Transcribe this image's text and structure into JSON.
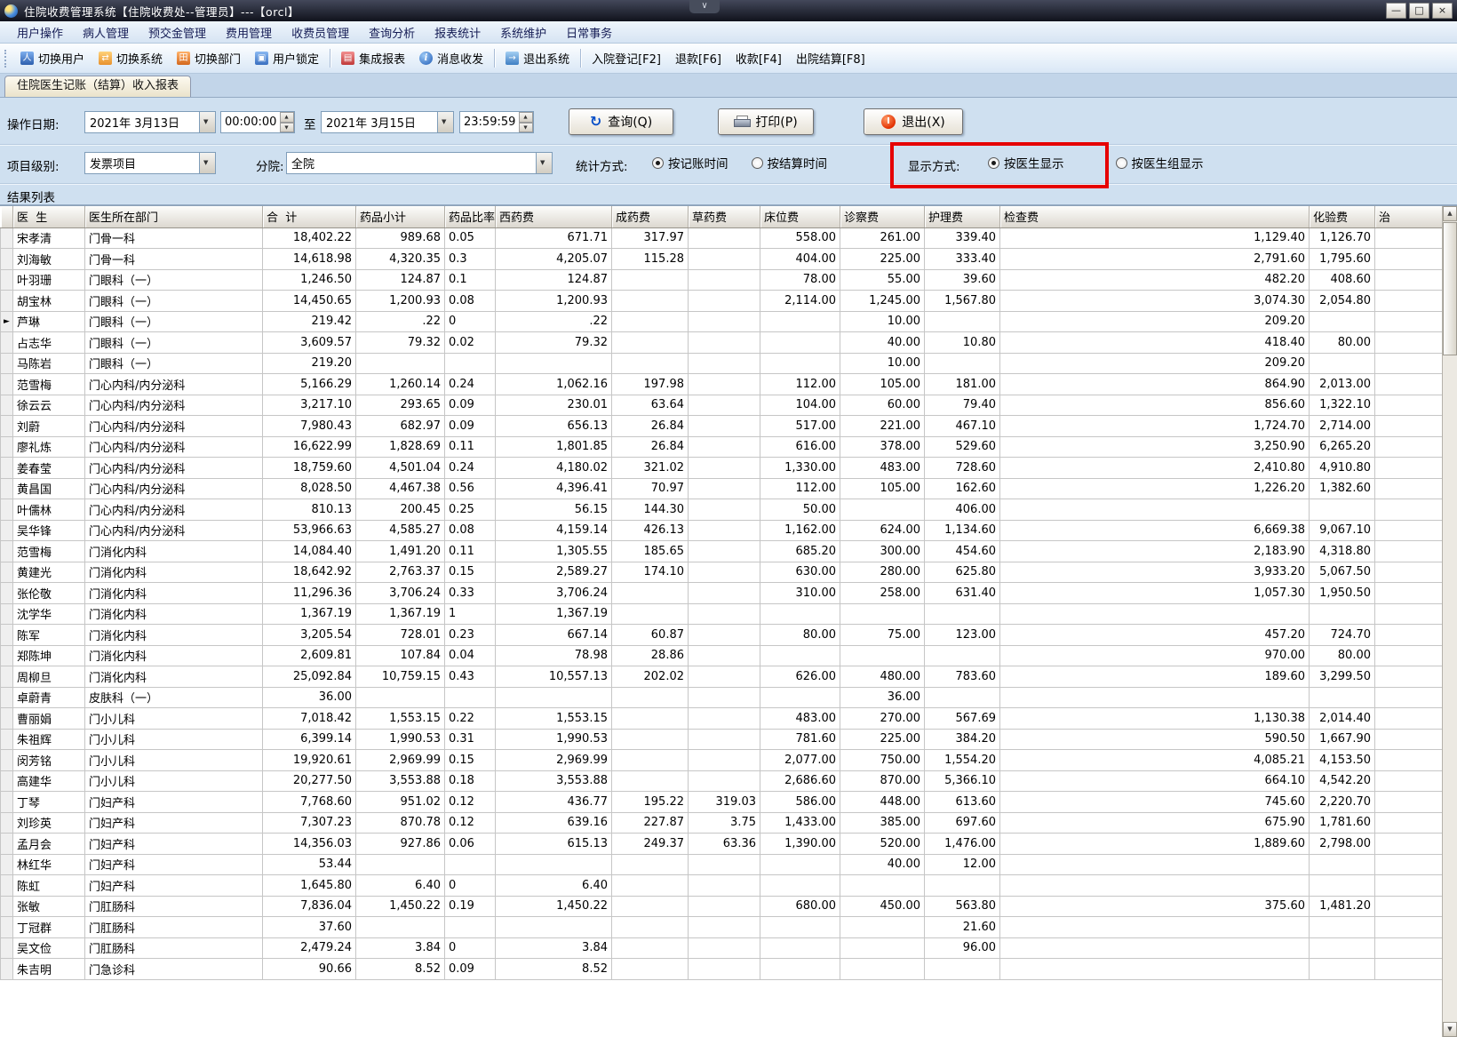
{
  "window": {
    "title": "住院收费管理系统【住院收费处--管理员】---【orcl】",
    "buttons": [
      "minimize",
      "maximize",
      "close"
    ]
  },
  "menu": {
    "items": [
      "用户操作",
      "病人管理",
      "预交金管理",
      "费用管理",
      "收费员管理",
      "查询分析",
      "报表统计",
      "系统维护",
      "日常事务"
    ]
  },
  "toolbar": {
    "groups": [
      {
        "items": [
          {
            "icon": "switch-user",
            "label": "切换用户"
          },
          {
            "icon": "switch-system",
            "label": "切换系统"
          },
          {
            "icon": "switch-department",
            "label": "切换部门"
          },
          {
            "icon": "user-lock",
            "label": "用户锁定"
          }
        ]
      },
      {
        "items": [
          {
            "icon": "integrated-report",
            "label": "集成报表"
          },
          {
            "icon": "message",
            "label": "消息收发"
          }
        ]
      },
      {
        "items": [
          {
            "icon": "exit-system",
            "label": "退出系统"
          }
        ]
      },
      {
        "items": [
          {
            "icon": "",
            "label": "入院登记[F2]"
          },
          {
            "icon": "",
            "label": "退款[F6]"
          },
          {
            "icon": "",
            "label": "收款[F4]"
          },
          {
            "icon": "",
            "label": "出院结算[F8]"
          }
        ]
      }
    ]
  },
  "tab": {
    "label": "住院医生记账（结算）收入报表"
  },
  "filters": {
    "date_label": "操作日期:",
    "date_from": "2021年 3月13日",
    "time_from": "00:00:00",
    "to_label": "至",
    "date_to": "2021年 3月15日",
    "time_to": "23:59:59",
    "query_button": "查询(Q)",
    "print_button": "打印(P)",
    "exit_button": "退出(X)",
    "level_label": "项目级别:",
    "level_value": "发票项目",
    "branch_label": "分院:",
    "branch_value": "全院",
    "stat": {
      "label": "统计方式:",
      "options": [
        {
          "label": "按记账时间",
          "selected": true
        },
        {
          "label": "按结算时间",
          "selected": false
        }
      ]
    },
    "display": {
      "label": "显示方式:",
      "options": [
        {
          "label": "按医生显示",
          "selected": true
        },
        {
          "label": "按医生组显示",
          "selected": false
        }
      ]
    },
    "highlight_color": "#e60000"
  },
  "results": {
    "section_label": "结果列表",
    "selected_row": 4,
    "partial_column": "治",
    "columns": [
      "医  生",
      "医生所在部门",
      "合  计",
      "药品小计",
      "药品比率",
      "西药费",
      "成药费",
      "草药费",
      "床位费",
      "诊察费",
      "护理费",
      "检查费",
      "化验费"
    ],
    "rows": [
      [
        "宋孝清",
        "门骨一科",
        "18,402.22",
        "989.68",
        "0.05",
        "671.71",
        "317.97",
        "",
        "558.00",
        "261.00",
        "339.40",
        "1,129.40",
        "1,126.70"
      ],
      [
        "刘海敏",
        "门骨一科",
        "14,618.98",
        "4,320.35",
        "0.3",
        "4,205.07",
        "115.28",
        "",
        "404.00",
        "225.00",
        "333.40",
        "2,791.60",
        "1,795.60"
      ],
      [
        "叶羽珊",
        "门眼科（一）",
        "1,246.50",
        "124.87",
        "0.1",
        "124.87",
        "",
        "",
        "78.00",
        "55.00",
        "39.60",
        "482.20",
        "408.60"
      ],
      [
        "胡宝林",
        "门眼科（一）",
        "14,450.65",
        "1,200.93",
        "0.08",
        "1,200.93",
        "",
        "",
        "2,114.00",
        "1,245.00",
        "1,567.80",
        "3,074.30",
        "2,054.80"
      ],
      [
        "芦琳",
        "门眼科（一）",
        "219.42",
        ".22",
        "0",
        ".22",
        "",
        "",
        "",
        "10.00",
        "",
        "209.20",
        ""
      ],
      [
        "占志华",
        "门眼科（一）",
        "3,609.57",
        "79.32",
        "0.02",
        "79.32",
        "",
        "",
        "",
        "40.00",
        "10.80",
        "418.40",
        "80.00"
      ],
      [
        "马陈岩",
        "门眼科（一）",
        "219.20",
        "",
        "",
        "",
        "",
        "",
        "",
        "10.00",
        "",
        "209.20",
        ""
      ],
      [
        "范雪梅",
        "门心内科/内分泌科",
        "5,166.29",
        "1,260.14",
        "0.24",
        "1,062.16",
        "197.98",
        "",
        "112.00",
        "105.00",
        "181.00",
        "864.90",
        "2,013.00"
      ],
      [
        "徐云云",
        "门心内科/内分泌科",
        "3,217.10",
        "293.65",
        "0.09",
        "230.01",
        "63.64",
        "",
        "104.00",
        "60.00",
        "79.40",
        "856.60",
        "1,322.10"
      ],
      [
        "刘蔚",
        "门心内科/内分泌科",
        "7,980.43",
        "682.97",
        "0.09",
        "656.13",
        "26.84",
        "",
        "517.00",
        "221.00",
        "467.10",
        "1,724.70",
        "2,714.00"
      ],
      [
        "廖礼炼",
        "门心内科/内分泌科",
        "16,622.99",
        "1,828.69",
        "0.11",
        "1,801.85",
        "26.84",
        "",
        "616.00",
        "378.00",
        "529.60",
        "3,250.90",
        "6,265.20"
      ],
      [
        "姜春莹",
        "门心内科/内分泌科",
        "18,759.60",
        "4,501.04",
        "0.24",
        "4,180.02",
        "321.02",
        "",
        "1,330.00",
        "483.00",
        "728.60",
        "2,410.80",
        "4,910.80"
      ],
      [
        "黄昌国",
        "门心内科/内分泌科",
        "8,028.50",
        "4,467.38",
        "0.56",
        "4,396.41",
        "70.97",
        "",
        "112.00",
        "105.00",
        "162.60",
        "1,226.20",
        "1,382.60"
      ],
      [
        "叶儒林",
        "门心内科/内分泌科",
        "810.13",
        "200.45",
        "0.25",
        "56.15",
        "144.30",
        "",
        "50.00",
        "",
        "406.00",
        "",
        ""
      ],
      [
        "吴华锋",
        "门心内科/内分泌科",
        "53,966.63",
        "4,585.27",
        "0.08",
        "4,159.14",
        "426.13",
        "",
        "1,162.00",
        "624.00",
        "1,134.60",
        "6,669.38",
        "9,067.10"
      ],
      [
        "范雪梅",
        "门消化内科",
        "14,084.40",
        "1,491.20",
        "0.11",
        "1,305.55",
        "185.65",
        "",
        "685.20",
        "300.00",
        "454.60",
        "2,183.90",
        "4,318.80"
      ],
      [
        "黄建光",
        "门消化内科",
        "18,642.92",
        "2,763.37",
        "0.15",
        "2,589.27",
        "174.10",
        "",
        "630.00",
        "280.00",
        "625.80",
        "3,933.20",
        "5,067.50"
      ],
      [
        "张伦敬",
        "门消化内科",
        "11,296.36",
        "3,706.24",
        "0.33",
        "3,706.24",
        "",
        "",
        "310.00",
        "258.00",
        "631.40",
        "1,057.30",
        "1,950.50"
      ],
      [
        "沈学华",
        "门消化内科",
        "1,367.19",
        "1,367.19",
        "1",
        "1,367.19",
        "",
        "",
        "",
        "",
        "",
        "",
        ""
      ],
      [
        "陈军",
        "门消化内科",
        "3,205.54",
        "728.01",
        "0.23",
        "667.14",
        "60.87",
        "",
        "80.00",
        "75.00",
        "123.00",
        "457.20",
        "724.70"
      ],
      [
        "郑陈坤",
        "门消化内科",
        "2,609.81",
        "107.84",
        "0.04",
        "78.98",
        "28.86",
        "",
        "",
        "",
        "",
        "970.00",
        "80.00"
      ],
      [
        "周柳旦",
        "门消化内科",
        "25,092.84",
        "10,759.15",
        "0.43",
        "10,557.13",
        "202.02",
        "",
        "626.00",
        "480.00",
        "783.60",
        "189.60",
        "3,299.50"
      ],
      [
        "卓蔚青",
        "皮肤科（一）",
        "36.00",
        "",
        "",
        "",
        "",
        "",
        "",
        "36.00",
        "",
        "",
        ""
      ],
      [
        "曹丽娟",
        "门小儿科",
        "7,018.42",
        "1,553.15",
        "0.22",
        "1,553.15",
        "",
        "",
        "483.00",
        "270.00",
        "567.69",
        "1,130.38",
        "2,014.40"
      ],
      [
        "朱祖辉",
        "门小儿科",
        "6,399.14",
        "1,990.53",
        "0.31",
        "1,990.53",
        "",
        "",
        "781.60",
        "225.00",
        "384.20",
        "590.50",
        "1,667.90"
      ],
      [
        "闵芳铭",
        "门小儿科",
        "19,920.61",
        "2,969.99",
        "0.15",
        "2,969.99",
        "",
        "",
        "2,077.00",
        "750.00",
        "1,554.20",
        "4,085.21",
        "4,153.50"
      ],
      [
        "高建华",
        "门小儿科",
        "20,277.50",
        "3,553.88",
        "0.18",
        "3,553.88",
        "",
        "",
        "2,686.60",
        "870.00",
        "5,366.10",
        "664.10",
        "4,542.20"
      ],
      [
        "丁琴",
        "门妇产科",
        "7,768.60",
        "951.02",
        "0.12",
        "436.77",
        "195.22",
        "319.03",
        "586.00",
        "448.00",
        "613.60",
        "745.60",
        "2,220.70"
      ],
      [
        "刘珍英",
        "门妇产科",
        "7,307.23",
        "870.78",
        "0.12",
        "639.16",
        "227.87",
        "3.75",
        "1,433.00",
        "385.00",
        "697.60",
        "675.90",
        "1,781.60"
      ],
      [
        "孟月会",
        "门妇产科",
        "14,356.03",
        "927.86",
        "0.06",
        "615.13",
        "249.37",
        "63.36",
        "1,390.00",
        "520.00",
        "1,476.00",
        "1,889.60",
        "2,798.00"
      ],
      [
        "林红华",
        "门妇产科",
        "53.44",
        "",
        "",
        "",
        "",
        "",
        "",
        "40.00",
        "12.00",
        "",
        ""
      ],
      [
        "陈虹",
        "门妇产科",
        "1,645.80",
        "6.40",
        "0",
        "6.40",
        "",
        "",
        "",
        "",
        "",
        "",
        ""
      ],
      [
        "张敏",
        "门肛肠科",
        "7,836.04",
        "1,450.22",
        "0.19",
        "1,450.22",
        "",
        "",
        "680.00",
        "450.00",
        "563.80",
        "375.60",
        "1,481.20"
      ],
      [
        "丁冠群",
        "门肛肠科",
        "37.60",
        "",
        "",
        "",
        "",
        "",
        "",
        "",
        "21.60",
        "",
        ""
      ],
      [
        "吴文俭",
        "门肛肠科",
        "2,479.24",
        "3.84",
        "0",
        "3.84",
        "",
        "",
        "",
        "",
        "96.00",
        "",
        ""
      ],
      [
        "朱吉明",
        "门急诊科",
        "90.66",
        "8.52",
        "0.09",
        "8.52",
        "",
        "",
        "",
        "",
        "",
        "",
        ""
      ]
    ]
  }
}
